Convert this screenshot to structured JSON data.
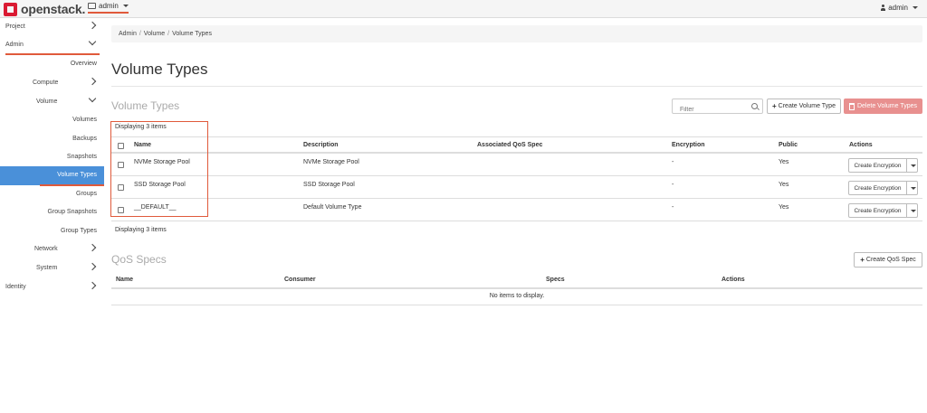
{
  "navbar": {
    "logo_text": "openstack.",
    "project": "admin",
    "user": "admin"
  },
  "sidebar": {
    "items": [
      {
        "label": "Project"
      },
      {
        "label": "Admin"
      },
      {
        "label": "Overview"
      },
      {
        "label": "Compute"
      },
      {
        "label": "Volume"
      },
      {
        "label": "Volumes"
      },
      {
        "label": "Backups"
      },
      {
        "label": "Snapshots"
      },
      {
        "label": "Volume Types"
      },
      {
        "label": "Groups"
      },
      {
        "label": "Group Snapshots"
      },
      {
        "label": "Group Types"
      },
      {
        "label": "Network"
      },
      {
        "label": "System"
      },
      {
        "label": "Identity"
      }
    ]
  },
  "breadcrumb": [
    "Admin",
    "Volume",
    "Volume Types"
  ],
  "page_title": "Volume Types",
  "volume_types": {
    "section_title": "Volume Types",
    "filter_placeholder": "Filter",
    "create_label": "Create Volume Type",
    "delete_label": "Delete Volume Types",
    "displaying_top": "Displaying 3 items",
    "displaying_bottom": "Displaying 3 items",
    "columns": [
      "Name",
      "Description",
      "Associated QoS Spec",
      "Encryption",
      "Public",
      "Actions"
    ],
    "rows": [
      {
        "name": "NVMe Storage Pool",
        "description": "NVMe Storage Pool",
        "qos": "",
        "encryption": "-",
        "public": "Yes",
        "action": "Create Encryption"
      },
      {
        "name": "SSD Storage Pool",
        "description": "SSD Storage Pool",
        "qos": "",
        "encryption": "-",
        "public": "Yes",
        "action": "Create Encryption"
      },
      {
        "name": "__DEFAULT__",
        "description": "Default Volume Type",
        "qos": "",
        "encryption": "-",
        "public": "Yes",
        "action": "Create Encryption"
      }
    ]
  },
  "qos_specs": {
    "section_title": "QoS Specs",
    "create_label": "Create QoS Spec",
    "columns": [
      "Name",
      "Consumer",
      "Specs",
      "Actions"
    ],
    "empty_text": "No items to display."
  },
  "colors": {
    "accent": "#4a90d9",
    "danger": "#e8908f",
    "highlight": "#e05a3b"
  }
}
